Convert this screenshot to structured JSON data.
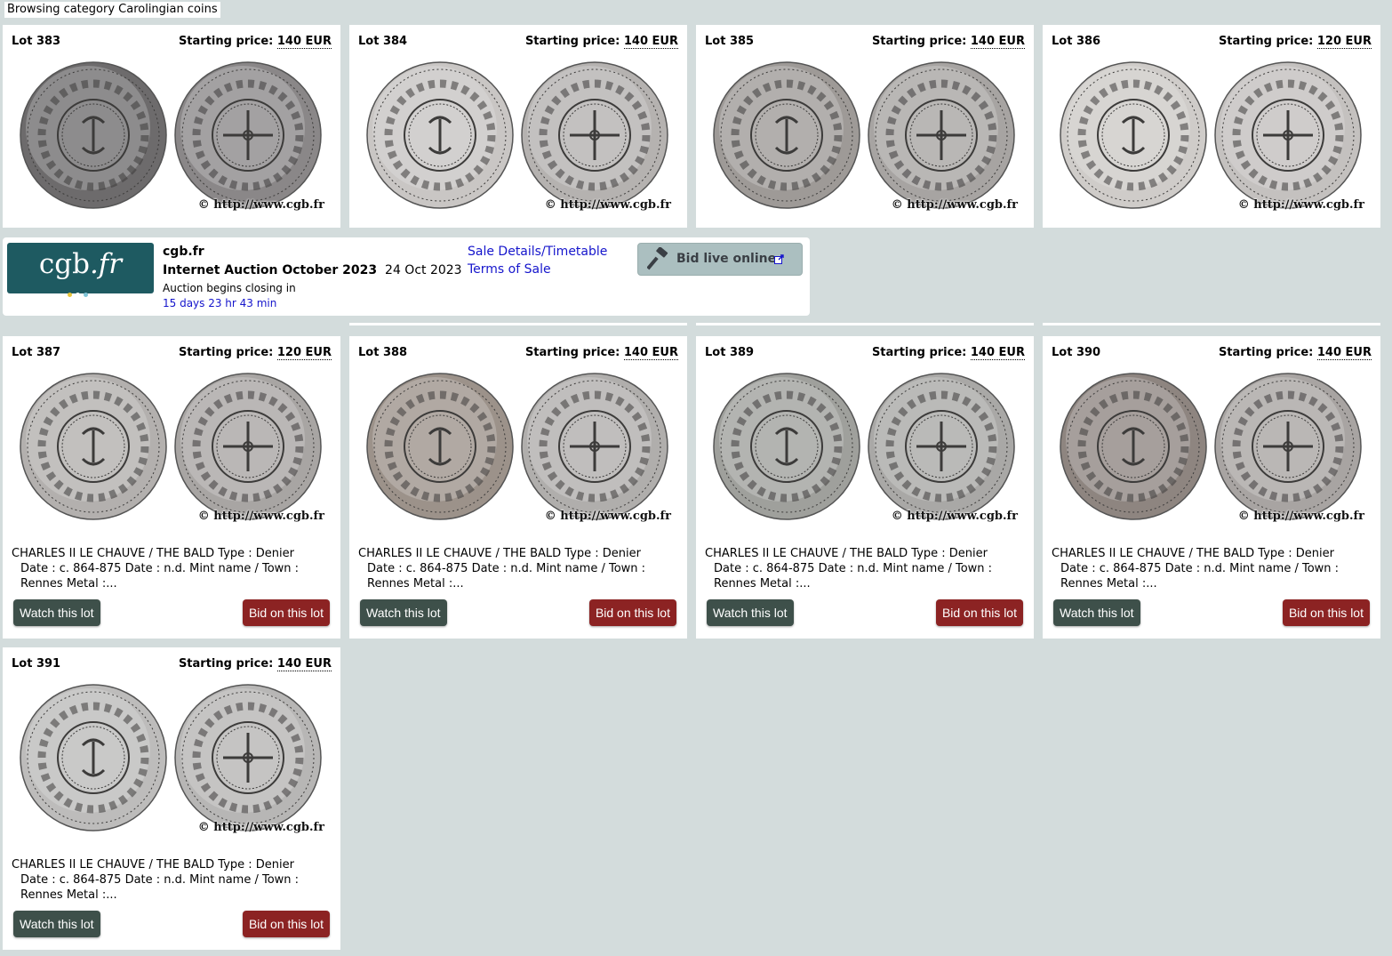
{
  "breadcrumb": "Browsing category Carolingian coins",
  "price_label": "Starting price:",
  "watermark": "© http://www.cgb.fr",
  "buttons": {
    "watch": "Watch this lot",
    "bid": "Bid on this lot"
  },
  "lots": [
    {
      "label": "Lot 383",
      "price": "140 EUR"
    },
    {
      "label": "Lot 384",
      "price": "140 EUR"
    },
    {
      "label": "Lot 385",
      "price": "140 EUR"
    },
    {
      "label": "Lot 386",
      "price": "120 EUR"
    },
    {
      "label": "Lot 387",
      "price": "120 EUR",
      "desc_line1": "CHARLES II LE CHAUVE / THE BALD Type : Denier",
      "desc_line2": "Date : c. 864-875 Date : n.d. Mint name / Town :",
      "desc_line3": "Rennes Metal :..."
    },
    {
      "label": "Lot 388",
      "price": "140 EUR",
      "desc_line1": "CHARLES II LE CHAUVE / THE BALD Type : Denier",
      "desc_line2": "Date : c. 864-875 Date : n.d. Mint name / Town :",
      "desc_line3": "Rennes Metal :..."
    },
    {
      "label": "Lot 389",
      "price": "140 EUR",
      "desc_line1": "CHARLES II LE CHAUVE / THE BALD Type : Denier",
      "desc_line2": "Date : c. 864-875 Date : n.d. Mint name / Town :",
      "desc_line3": "Rennes Metal :..."
    },
    {
      "label": "Lot 390",
      "price": "140 EUR",
      "desc_line1": "CHARLES II LE CHAUVE / THE BALD Type : Denier",
      "desc_line2": "Date : c. 864-875 Date : n.d. Mint name / Town :",
      "desc_line3": "Rennes Metal :..."
    },
    {
      "label": "Lot 391",
      "price": "140 EUR",
      "desc_line1": "CHARLES II LE CHAUVE / THE BALD Type : Denier",
      "desc_line2": "Date : c. 864-875 Date : n.d. Mint name / Town :",
      "desc_line3": "Rennes Metal :..."
    }
  ],
  "banner": {
    "logo_text": "cgb",
    "logo_suffix": ".fr",
    "site": "cgb.fr",
    "auction_title": "Internet Auction October 2023",
    "auction_date": "24 Oct 2023",
    "closing_label": "Auction begins closing in",
    "countdown": "15 days 23 hr 43 min",
    "link_sale_details": "Sale Details/Timetable",
    "link_terms": "Terms of Sale",
    "bid_live": "Bid live online",
    "logo_dot_colors": [
      "#e8c53a",
      "#ffffff",
      "#7fc4d6"
    ]
  },
  "colors": {
    "page_bg": "#d3dcdc",
    "watch_button": "#3e504a",
    "bid_button": "#8c2323",
    "link": "#1515cc",
    "logo_bg": "#1e5a61"
  }
}
